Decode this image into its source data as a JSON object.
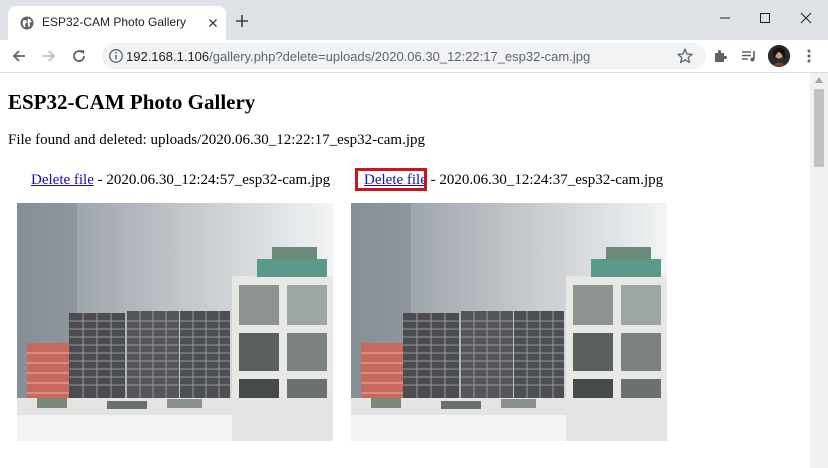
{
  "browser": {
    "tab_title": "ESP32-CAM Photo Gallery",
    "url_host": "192.168.1.106",
    "url_path": "/gallery.php?delete=uploads/2020.06.30_12:22:17_esp32-cam.jpg"
  },
  "page": {
    "heading": "ESP32-CAM Photo Gallery",
    "status_message": "File found and deleted: uploads/2020.06.30_12:22:17_esp32-cam.jpg",
    "gallery": [
      {
        "link_label": "Delete file",
        "separator": " - ",
        "filename": "2020.06.30_12:24:57_esp32-cam.jpg"
      },
      {
        "link_label": "Delete file",
        "separator": " - ",
        "filename": "2020.06.30_12:24:37_esp32-cam.jpg"
      }
    ]
  },
  "colors": {
    "link": "#1a0dab",
    "highlight_border": "#d0121b",
    "titlebar": "#dee1e6"
  }
}
